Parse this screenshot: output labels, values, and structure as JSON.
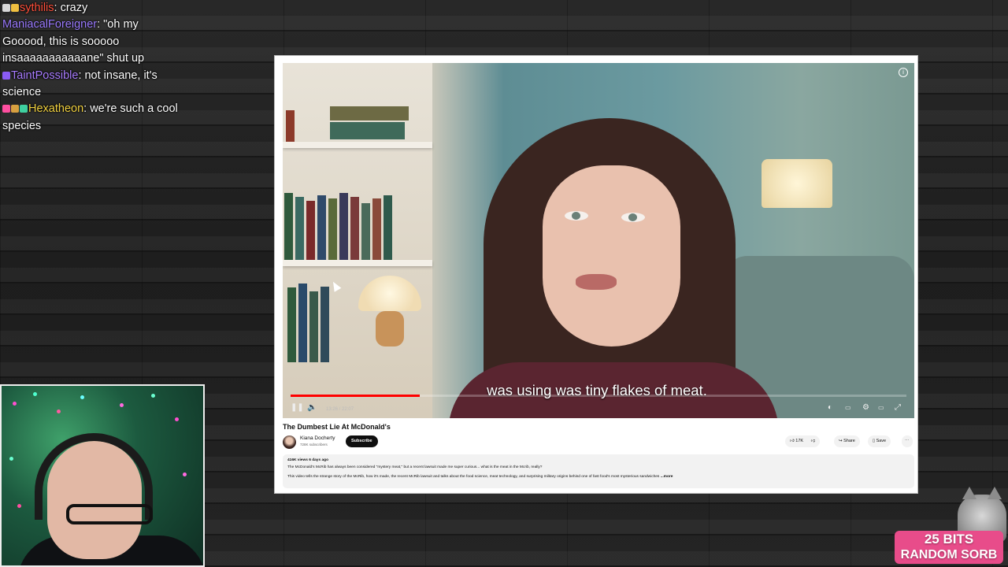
{
  "chat": {
    "messages": [
      {
        "user": "sythilis",
        "color": "#ff4f3a",
        "badges": [
          "#d8d8d8",
          "#f0c040"
        ],
        "text": ": crazy"
      },
      {
        "user": "ManiacalForeigner",
        "color": "#9b7bff",
        "badges": [],
        "text": ": \"oh my Gooood, this is sooooo insaaaaaaaaaaane\" shut up"
      },
      {
        "user": "TaintPossible",
        "color": "#a87cff",
        "badges": [
          "#8a5cf5"
        ],
        "text": ": not insane, it's science"
      },
      {
        "user": "Hexatheon",
        "color": "#f0d040",
        "badges": [
          "#ff4fa0",
          "#d8a040",
          "#3fd0a0"
        ],
        "text": ": we're such a cool species"
      }
    ]
  },
  "video": {
    "caption": "was using was tiny flakes of meat.",
    "time": "13:26 / 22:07",
    "progress": 0.21,
    "title": "The Dumbest Lie At McDonald's"
  },
  "channel": {
    "name": "Kiana Docherty",
    "subs": "728K subscribers",
    "subscribe_label": "Subscribe",
    "likes": "17K",
    "share_label": "Share",
    "save_label": "Save",
    "more_icon": "⋯"
  },
  "description": {
    "stats": "416K views  6 days ago",
    "line1": "The McDonald's McRib has always been considered \"mystery meat,\" but a recent lawsuit  made me super curious... what is the meat in the Mcrib, really?",
    "line2": "This video tells the strange story of the McRib, how it's made, the recent McRib lawsuit  and talks about the food science, meat technology, and surprising military origins behind one of fast food's most mysterious sandwiches",
    "more": "...more"
  },
  "alert": {
    "top": "25 BITS",
    "bottom": "RANDOM SORB"
  }
}
